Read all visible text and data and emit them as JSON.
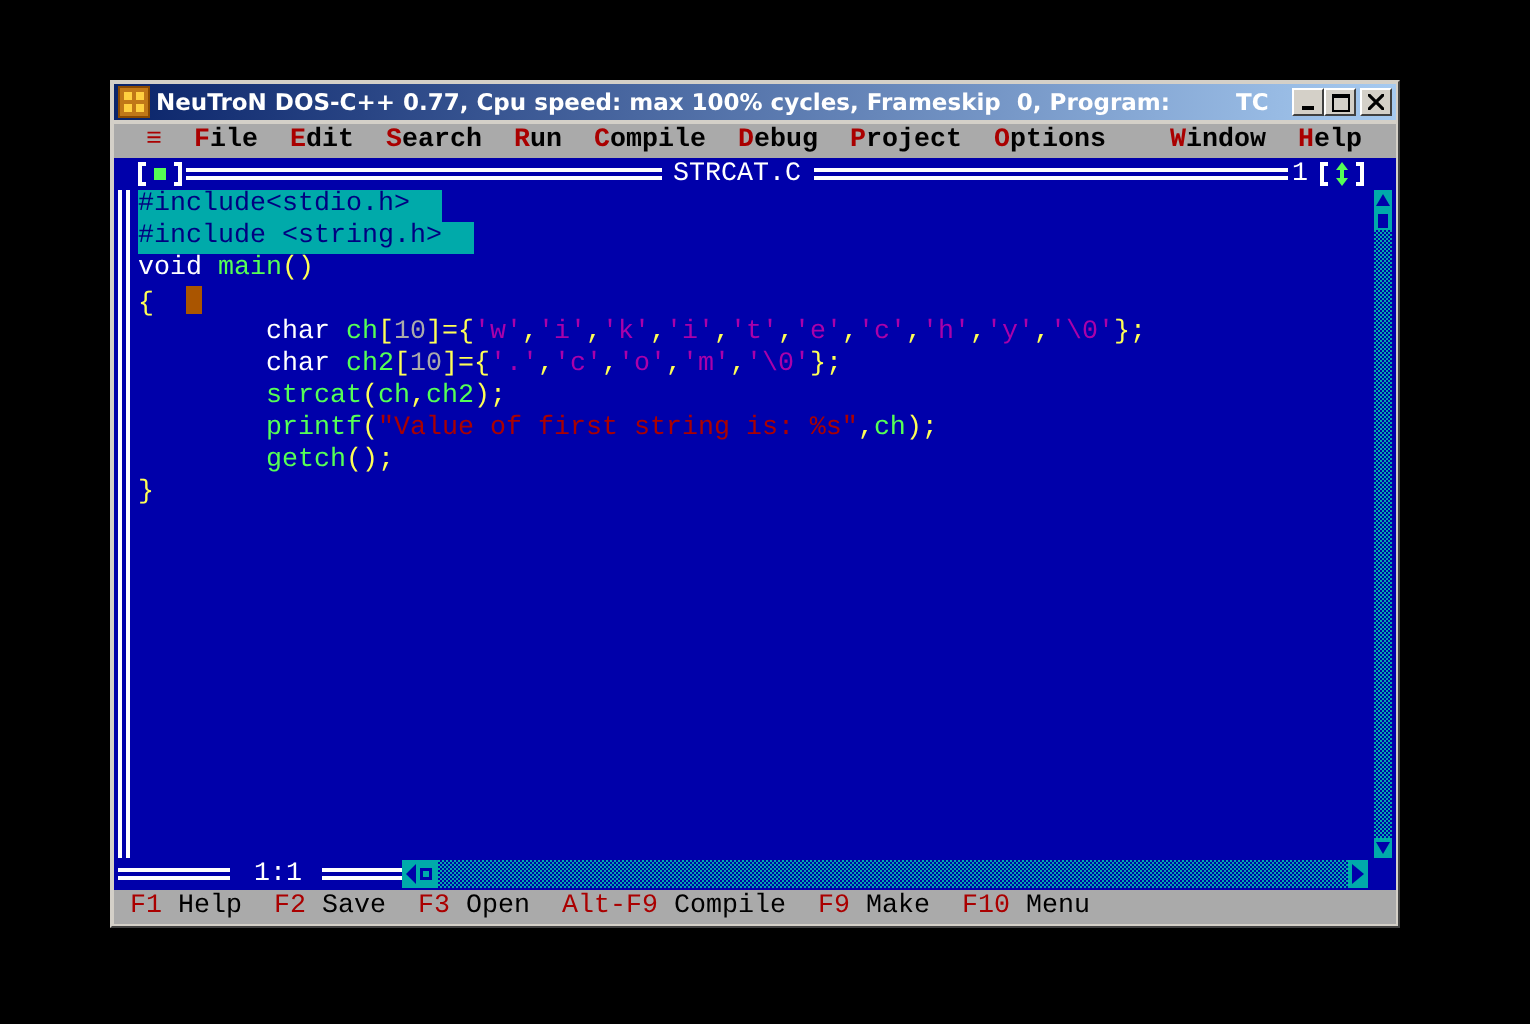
{
  "window": {
    "title": "NeuTroN DOS-C++ 0.77, Cpu speed: max 100% cycles, Frameskip  0, Program:",
    "program": "TC"
  },
  "menu": {
    "left": [
      {
        "label": "≡"
      },
      {
        "label": "File"
      },
      {
        "label": "Edit"
      },
      {
        "label": "Search"
      },
      {
        "label": "Run"
      },
      {
        "label": "Compile"
      },
      {
        "label": "Debug"
      },
      {
        "label": "Project"
      },
      {
        "label": "Options"
      }
    ],
    "right": [
      {
        "label": "Window"
      },
      {
        "label": "Help"
      }
    ]
  },
  "editor": {
    "title": "STRCAT.C",
    "window_number": "1",
    "position": "1:1",
    "lines": [
      {
        "selected": true,
        "cursor": false,
        "tokens": [
          {
            "kind": "plain",
            "text": "#include<stdio.h>"
          }
        ]
      },
      {
        "selected": true,
        "cursor": false,
        "tokens": [
          {
            "kind": "plain",
            "text": "#include <string.h>"
          }
        ]
      },
      {
        "selected": false,
        "cursor": false,
        "tokens": [
          {
            "kind": "plain",
            "text": "void "
          },
          {
            "kind": "ident",
            "text": "main"
          },
          {
            "kind": "punct",
            "text": "()"
          }
        ]
      },
      {
        "selected": false,
        "cursor": true,
        "tokens": [
          {
            "kind": "punct",
            "text": "{"
          }
        ]
      },
      {
        "selected": false,
        "cursor": false,
        "tokens": [
          {
            "kind": "plain",
            "text": "        char "
          },
          {
            "kind": "ident",
            "text": "ch"
          },
          {
            "kind": "punct",
            "text": "["
          },
          {
            "kind": "number",
            "text": "10"
          },
          {
            "kind": "punct",
            "text": "]={"
          },
          {
            "kind": "char",
            "text": "'w'"
          },
          {
            "kind": "punct",
            "text": ","
          },
          {
            "kind": "char",
            "text": "'i'"
          },
          {
            "kind": "punct",
            "text": ","
          },
          {
            "kind": "char",
            "text": "'k'"
          },
          {
            "kind": "punct",
            "text": ","
          },
          {
            "kind": "char",
            "text": "'i'"
          },
          {
            "kind": "punct",
            "text": ","
          },
          {
            "kind": "char",
            "text": "'t'"
          },
          {
            "kind": "punct",
            "text": ","
          },
          {
            "kind": "char",
            "text": "'e'"
          },
          {
            "kind": "punct",
            "text": ","
          },
          {
            "kind": "char",
            "text": "'c'"
          },
          {
            "kind": "punct",
            "text": ","
          },
          {
            "kind": "char",
            "text": "'h'"
          },
          {
            "kind": "punct",
            "text": ","
          },
          {
            "kind": "char",
            "text": "'y'"
          },
          {
            "kind": "punct",
            "text": ","
          },
          {
            "kind": "char",
            "text": "'\\0'"
          },
          {
            "kind": "punct",
            "text": "};"
          }
        ]
      },
      {
        "selected": false,
        "cursor": false,
        "tokens": [
          {
            "kind": "plain",
            "text": "        char "
          },
          {
            "kind": "ident",
            "text": "ch2"
          },
          {
            "kind": "punct",
            "text": "["
          },
          {
            "kind": "number",
            "text": "10"
          },
          {
            "kind": "punct",
            "text": "]={"
          },
          {
            "kind": "char",
            "text": "'.'"
          },
          {
            "kind": "punct",
            "text": ","
          },
          {
            "kind": "char",
            "text": "'c'"
          },
          {
            "kind": "punct",
            "text": ","
          },
          {
            "kind": "char",
            "text": "'o'"
          },
          {
            "kind": "punct",
            "text": ","
          },
          {
            "kind": "char",
            "text": "'m'"
          },
          {
            "kind": "punct",
            "text": ","
          },
          {
            "kind": "char",
            "text": "'\\0'"
          },
          {
            "kind": "punct",
            "text": "};"
          }
        ]
      },
      {
        "selected": false,
        "cursor": false,
        "tokens": [
          {
            "kind": "ident",
            "text": "        strcat"
          },
          {
            "kind": "punct",
            "text": "("
          },
          {
            "kind": "ident",
            "text": "ch"
          },
          {
            "kind": "punct",
            "text": ","
          },
          {
            "kind": "ident",
            "text": "ch2"
          },
          {
            "kind": "punct",
            "text": ");"
          }
        ]
      },
      {
        "selected": false,
        "cursor": false,
        "tokens": [
          {
            "kind": "ident",
            "text": "        printf"
          },
          {
            "kind": "punct",
            "text": "("
          },
          {
            "kind": "string",
            "text": "\"Value of first string is: %s\""
          },
          {
            "kind": "punct",
            "text": ","
          },
          {
            "kind": "ident",
            "text": "ch"
          },
          {
            "kind": "punct",
            "text": ");"
          }
        ]
      },
      {
        "selected": false,
        "cursor": false,
        "tokens": [
          {
            "kind": "ident",
            "text": "        getch"
          },
          {
            "kind": "punct",
            "text": "();"
          }
        ]
      },
      {
        "selected": false,
        "cursor": false,
        "tokens": [
          {
            "kind": "punct",
            "text": "}"
          }
        ]
      }
    ]
  },
  "status_bar": [
    {
      "key": "F1",
      "label": "Help"
    },
    {
      "key": "F2",
      "label": "Save"
    },
    {
      "key": "F3",
      "label": "Open"
    },
    {
      "key": "Alt-F9",
      "label": "Compile"
    },
    {
      "key": "F9",
      "label": "Make"
    },
    {
      "key": "F10",
      "label": "Menu"
    }
  ]
}
